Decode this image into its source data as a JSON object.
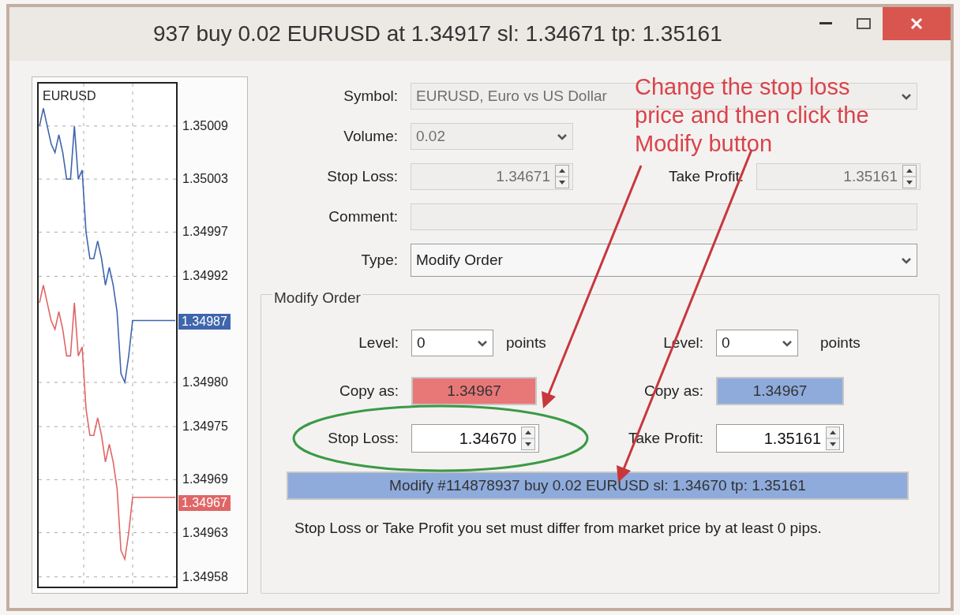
{
  "window": {
    "title": "937 buy 0.02 EURUSD at 1.34917 sl: 1.34671 tp: 1.35161"
  },
  "chart": {
    "chart_data": {
      "type": "line",
      "title": "EURUSD",
      "grid": true,
      "series": [
        {
          "color": "#3f66ad",
          "values": [
            1.35009,
            1.35011,
            1.35009,
            1.35007,
            1.35006,
            1.35008,
            1.35006,
            1.35003,
            1.35003,
            1.35009,
            1.35003,
            1.35004,
            1.34997,
            1.34994,
            1.34994,
            1.34996,
            1.34994,
            1.34991,
            1.34993,
            1.34991,
            1.34988,
            1.34981,
            1.3498,
            1.34983,
            1.34987,
            1.34987,
            1.34987,
            1.34987,
            1.34987,
            1.34987,
            1.34987,
            1.34987,
            1.34987,
            1.34987,
            1.34987,
            1.34987
          ]
        },
        {
          "color": "#e06666",
          "values": [
            1.34989,
            1.34991,
            1.34989,
            1.34987,
            1.34986,
            1.34988,
            1.34986,
            1.34983,
            1.34983,
            1.34989,
            1.34983,
            1.34984,
            1.34977,
            1.34974,
            1.34974,
            1.34976,
            1.34974,
            1.34971,
            1.34973,
            1.34971,
            1.34968,
            1.34961,
            1.3496,
            1.34963,
            1.34967,
            1.34967,
            1.34967,
            1.34967,
            1.34967,
            1.34967,
            1.34967,
            1.34967,
            1.34967,
            1.34967,
            1.34967,
            1.34967
          ]
        }
      ],
      "ylim": [
        1.349569,
        1.350138
      ],
      "yticks": [
        {
          "value": 1.35009,
          "label": "1.35009"
        },
        {
          "value": 1.35003,
          "label": "1.35003"
        },
        {
          "value": 1.34997,
          "label": "1.34997"
        },
        {
          "value": 1.34992,
          "label": "1.34992"
        },
        {
          "value": 1.3498,
          "label": "1.34980"
        },
        {
          "value": 1.34975,
          "label": "1.34975"
        },
        {
          "value": 1.34969,
          "label": "1.34969"
        },
        {
          "value": 1.34963,
          "label": "1.34963"
        },
        {
          "value": 1.34958,
          "label": "1.34958"
        }
      ]
    },
    "markers": [
      {
        "text": "1.34987",
        "color": "#3f66ad"
      },
      {
        "text": "1.34967",
        "color": "#e06666"
      }
    ]
  },
  "form": {
    "rows": [
      [
        {
          "label": "Symbol:",
          "kind": "combo",
          "value": "EURUSD, Euro vs US Dollar",
          "disabled": true
        }
      ],
      [
        {
          "label": "Volume:",
          "kind": "combo",
          "value": "0.02",
          "disabled": true
        }
      ],
      [
        {
          "label": "Stop Loss:",
          "kind": "spin",
          "value": "1.34671",
          "disabled": true
        },
        {
          "label": "Take Profit:",
          "kind": "spin",
          "value": "1.35161",
          "disabled": true
        }
      ],
      [
        {
          "label": "Comment:",
          "kind": "text",
          "disabled": true
        }
      ],
      [
        {
          "label": "Type:",
          "kind": "combo",
          "value": "Modify Order",
          "disabled": false
        }
      ]
    ]
  },
  "modify_order": {
    "title": "Modify Order",
    "levels": [
      {
        "label": "Level:",
        "value": "0",
        "unit": "points"
      },
      {
        "label": "Level:",
        "value": "0",
        "unit": "points"
      }
    ],
    "copy_as": [
      {
        "label": "Copy as:",
        "value": "1.34967",
        "color": "#e87777"
      },
      {
        "label": "Copy as:",
        "value": "1.34967",
        "color": "#8eabdc"
      }
    ],
    "inputs": [
      {
        "label": "Stop Loss:",
        "value": "1.34670"
      },
      {
        "label": "Take Profit:",
        "value": "1.35161"
      }
    ],
    "button": "Modify #114878937 buy 0.02 EURUSD sl: 1.34670 tp: 1.35161",
    "note": "Stop Loss or Take Profit you set must differ from market price by at least 0 pips."
  },
  "annotation": {
    "text": "Change the stop loss price and then click the Modify button"
  }
}
